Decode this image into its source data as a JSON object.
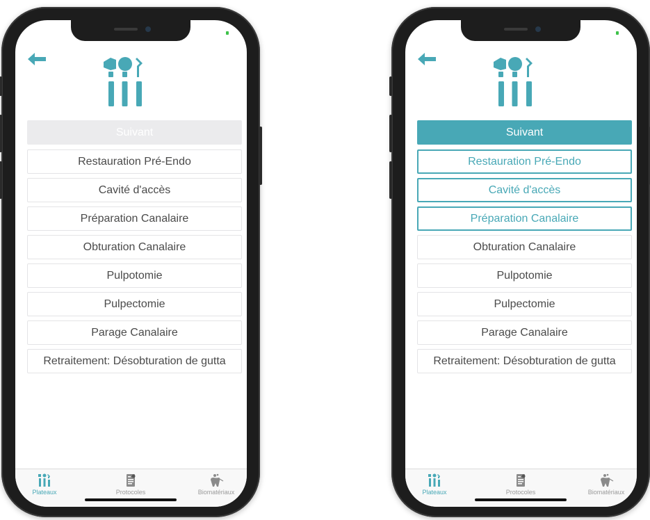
{
  "colors": {
    "accent": "#48a8b6",
    "inactive_button": "#ebebed",
    "text": "#4a4a4a",
    "tab_inactive": "#9a9a9a"
  },
  "left_screen": {
    "header": {
      "back_icon": "arrow-left-icon",
      "logo_icon": "dental-tools-icon"
    },
    "next_button": {
      "label": "Suivant",
      "state": "disabled"
    },
    "items": [
      {
        "label": "Restauration Pré-Endo",
        "selected": false
      },
      {
        "label": "Cavité d'accès",
        "selected": false
      },
      {
        "label": "Préparation Canalaire",
        "selected": false
      },
      {
        "label": "Obturation Canalaire",
        "selected": false
      },
      {
        "label": "Pulpotomie",
        "selected": false
      },
      {
        "label": "Pulpectomie",
        "selected": false
      },
      {
        "label": "Parage Canalaire",
        "selected": false
      },
      {
        "label": "Retraitement: Désobturation de gutta",
        "selected": false
      }
    ],
    "tabbar": [
      {
        "label": "Plateaux",
        "icon": "dental-tools-icon",
        "active": true
      },
      {
        "label": "Protocoles",
        "icon": "protocol-document-icon",
        "active": false
      },
      {
        "label": "Biomatériaux",
        "icon": "tooth-material-icon",
        "active": false
      }
    ]
  },
  "right_screen": {
    "header": {
      "back_icon": "arrow-left-icon",
      "logo_icon": "dental-tools-icon"
    },
    "next_button": {
      "label": "Suivant",
      "state": "enabled"
    },
    "items": [
      {
        "label": "Restauration Pré-Endo",
        "selected": true
      },
      {
        "label": "Cavité d'accès",
        "selected": true
      },
      {
        "label": "Préparation Canalaire",
        "selected": true
      },
      {
        "label": "Obturation Canalaire",
        "selected": false
      },
      {
        "label": "Pulpotomie",
        "selected": false
      },
      {
        "label": "Pulpectomie",
        "selected": false
      },
      {
        "label": "Parage Canalaire",
        "selected": false
      },
      {
        "label": "Retraitement: Désobturation de gutta",
        "selected": false
      }
    ],
    "tabbar": [
      {
        "label": "Plateaux",
        "icon": "dental-tools-icon",
        "active": true
      },
      {
        "label": "Protocoles",
        "icon": "protocol-document-icon",
        "active": false
      },
      {
        "label": "Biomatériaux",
        "icon": "tooth-material-icon",
        "active": false
      }
    ]
  }
}
